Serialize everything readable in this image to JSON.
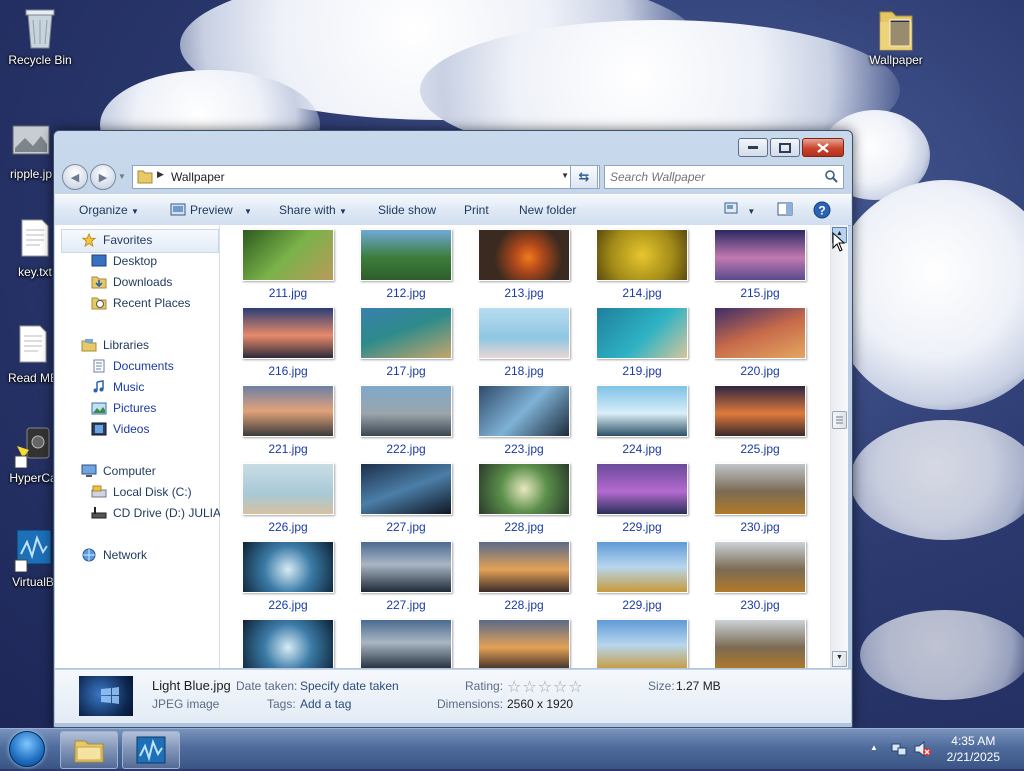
{
  "desktop": {
    "icons": [
      {
        "label": "Recycle Bin"
      },
      {
        "label": "ripple.jp"
      },
      {
        "label": "key.txt"
      },
      {
        "label": "Read ME"
      },
      {
        "label": "HyperCa"
      },
      {
        "label": "VirtualB"
      },
      {
        "label": "Wallpaper"
      }
    ]
  },
  "window": {
    "address": "Wallpaper",
    "search_placeholder": "Search Wallpaper",
    "toolbar": {
      "organize": "Organize",
      "preview": "Preview",
      "share_with": "Share with",
      "slide_show": "Slide show",
      "print": "Print",
      "new_folder": "New folder"
    },
    "nav": {
      "favorites": "Favorites",
      "desktop": "Desktop",
      "downloads": "Downloads",
      "recent": "Recent Places",
      "libraries": "Libraries",
      "documents": "Documents",
      "music": "Music",
      "pictures": "Pictures",
      "videos": "Videos",
      "computer": "Computer",
      "local_disk": "Local Disk (C:)",
      "cd_drive": "CD Drive (D:) JULIA",
      "network": "Network"
    },
    "files": [
      "211.jpg",
      "212.jpg",
      "213.jpg",
      "214.jpg",
      "215.jpg",
      "216.jpg",
      "217.jpg",
      "218.jpg",
      "219.jpg",
      "220.jpg",
      "221.jpg",
      "222.jpg",
      "223.jpg",
      "224.jpg",
      "225.jpg",
      "226.jpg",
      "227.jpg",
      "228.jpg",
      "229.jpg",
      "230.jpg",
      "226.jpg",
      "227.jpg",
      "228.jpg",
      "229.jpg",
      "230.jpg",
      "",
      "",
      "",
      "",
      ""
    ],
    "details": {
      "filename": "Light Blue.jpg",
      "filetype": "JPEG image",
      "date_label": "Date taken:",
      "date_value": "Specify date taken",
      "tags_label": "Tags:",
      "tags_value": "Add a tag",
      "rating_label": "Rating:",
      "rating_stars": 0,
      "dimensions_label": "Dimensions:",
      "dimensions_value": "2560 x 1920",
      "size_label": "Size:",
      "size_value": "1.27 MB"
    }
  },
  "taskbar": {
    "time": "4:35 AM",
    "date": "2/21/2025"
  }
}
